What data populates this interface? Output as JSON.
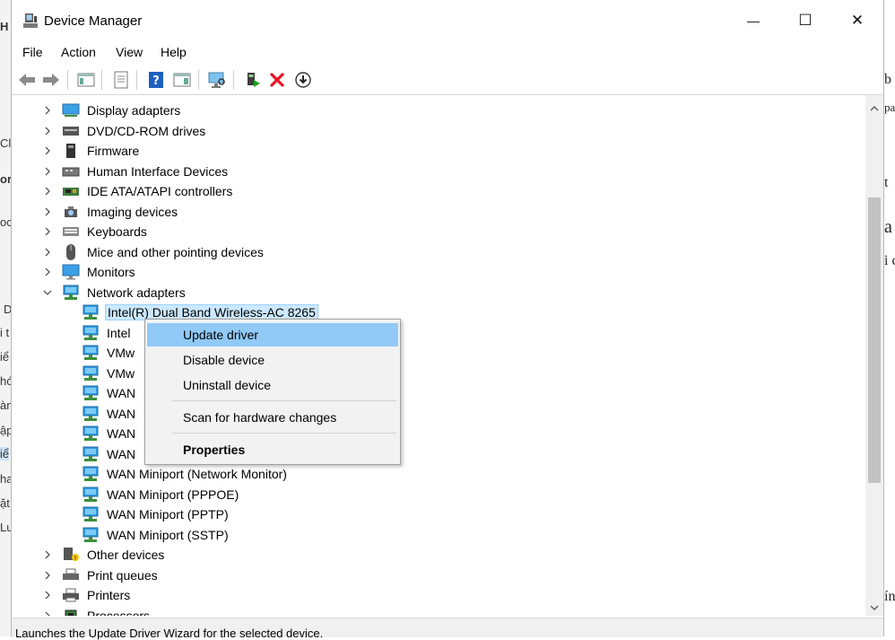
{
  "window": {
    "title": "Device Manager",
    "minimize_glyph": "—",
    "maximize_glyph": "☐",
    "close_glyph": "✕"
  },
  "menu": [
    "File",
    "Action",
    "View",
    "Help"
  ],
  "toolbar": {
    "icons": [
      "back-icon",
      "forward-icon",
      "show-hide-console-tree-icon",
      "properties-sheet-icon",
      "help-icon",
      "action-pane-icon",
      "scan-hardware-icon",
      "update-driver-icon",
      "uninstall-device-icon",
      "download-icon"
    ]
  },
  "tree": {
    "items": [
      {
        "label": "Display adapters",
        "icon": "display-adapter-icon",
        "expanded": false
      },
      {
        "label": "DVD/CD-ROM drives",
        "icon": "dvd-drive-icon",
        "expanded": false
      },
      {
        "label": "Firmware",
        "icon": "firmware-icon",
        "expanded": false
      },
      {
        "label": "Human Interface Devices",
        "icon": "hid-icon",
        "expanded": false
      },
      {
        "label": "IDE ATA/ATAPI controllers",
        "icon": "ide-controller-icon",
        "expanded": false
      },
      {
        "label": "Imaging devices",
        "icon": "camera-icon",
        "expanded": false
      },
      {
        "label": "Keyboards",
        "icon": "keyboard-icon",
        "expanded": false
      },
      {
        "label": "Mice and other pointing devices",
        "icon": "mouse-icon",
        "expanded": false
      },
      {
        "label": "Monitors",
        "icon": "monitor-icon",
        "expanded": false
      },
      {
        "label": "Network adapters",
        "icon": "network-adapter-icon",
        "expanded": true
      },
      {
        "label": "Intel(R) Dual Band Wireless-AC 8265",
        "icon": "network-adapter-icon",
        "child": true,
        "selected": true
      },
      {
        "label": "Intel",
        "icon": "network-adapter-icon",
        "child": true
      },
      {
        "label": "VMw",
        "icon": "network-adapter-icon",
        "child": true
      },
      {
        "label": "VMw",
        "icon": "network-adapter-icon",
        "child": true
      },
      {
        "label": "WAN",
        "icon": "network-adapter-icon",
        "child": true
      },
      {
        "label": "WAN",
        "icon": "network-adapter-icon",
        "child": true
      },
      {
        "label": "WAN",
        "icon": "network-adapter-icon",
        "child": true
      },
      {
        "label": "WAN",
        "icon": "network-adapter-icon",
        "child": true
      },
      {
        "label": "WAN Miniport (Network Monitor)",
        "icon": "network-adapter-icon",
        "child": true
      },
      {
        "label": "WAN Miniport (PPPOE)",
        "icon": "network-adapter-icon",
        "child": true
      },
      {
        "label": "WAN Miniport (PPTP)",
        "icon": "network-adapter-icon",
        "child": true
      },
      {
        "label": "WAN Miniport (SSTP)",
        "icon": "network-adapter-icon",
        "child": true
      },
      {
        "label": "Other devices",
        "icon": "other-devices-icon",
        "expanded": false
      },
      {
        "label": "Print queues",
        "icon": "print-queue-icon",
        "expanded": false
      },
      {
        "label": "Printers",
        "icon": "printer-icon",
        "expanded": false
      },
      {
        "label": "Processors",
        "icon": "processor-icon",
        "expanded": false
      }
    ]
  },
  "context_menu": {
    "items": [
      {
        "label": "Update driver",
        "highlighted": true
      },
      {
        "label": "Disable device"
      },
      {
        "label": "Uninstall device"
      },
      {
        "label": "Scan for hardware changes"
      },
      {
        "label": "Properties",
        "bold": true
      }
    ]
  },
  "status": "Launches the Update Driver Wizard for the selected device.",
  "background_app": {
    "left_fragments": [
      "H",
      "Cli",
      "or",
      "oc",
      "D",
      "i t",
      "iể",
      "hó",
      "àn",
      "ập",
      "iể",
      "ha",
      "ặt",
      "Lu"
    ],
    "right_fragments": [
      "b",
      "pa",
      "t",
      "a",
      "i c",
      "ín"
    ]
  },
  "colors": {
    "selection": "#cce8ff",
    "menu_highlight": "#91c9f7",
    "network_icon": "#2f9be0",
    "delete_red": "#e81123"
  }
}
